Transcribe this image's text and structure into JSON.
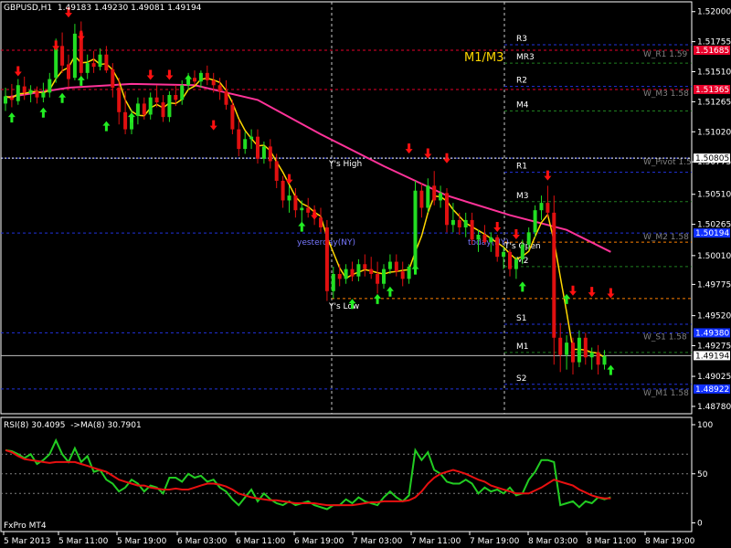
{
  "chart_data": {
    "type": "candlestick",
    "header": {
      "symbol": "GBPUSD,H1",
      "open": "1.49183",
      "high": "1.49230",
      "low": "1.49081",
      "close": "1.49194"
    },
    "price_axis_ticks": [
      {
        "value": 1.52,
        "label": "1.52000"
      },
      {
        "value": 1.51755,
        "label": "1.51755"
      },
      {
        "value": 1.5151,
        "label": "1.51510"
      },
      {
        "value": 1.51265,
        "label": "1.51265"
      },
      {
        "value": 1.5102,
        "label": "1.51020"
      },
      {
        "value": 1.50775,
        "label": "1.50775"
      },
      {
        "value": 1.5051,
        "label": "1.50510"
      },
      {
        "value": 1.50265,
        "label": "1.50265"
      },
      {
        "value": 1.5001,
        "label": "1.50010"
      },
      {
        "value": 1.49775,
        "label": "1.49775"
      },
      {
        "value": 1.4952,
        "label": "1.49520"
      },
      {
        "value": 1.49275,
        "label": "1.49275"
      },
      {
        "value": 1.49025,
        "label": "1.49025"
      },
      {
        "value": 1.4878,
        "label": "1.48780"
      }
    ],
    "price_range": [
      1.4872,
      1.5208
    ],
    "price_labels": [
      {
        "value": 1.51685,
        "label": "1.51685",
        "color": "#e8002a"
      },
      {
        "value": 1.51365,
        "label": "1.51365",
        "color": "#e8002a"
      },
      {
        "value": 1.50805,
        "label": "1.50805",
        "color": "#ffffff"
      },
      {
        "value": 1.50194,
        "label": "1.50194",
        "color": "#1030ff"
      },
      {
        "value": 1.4938,
        "label": "1.49380",
        "color": "#1030ff"
      },
      {
        "value": 1.49194,
        "label": "1.49194",
        "color": "#ffffff"
      },
      {
        "value": 1.48922,
        "label": "1.48922",
        "color": "#1030ff"
      }
    ],
    "time_axis": [
      "5 Mar 2013",
      "5 Mar 11:00",
      "5 Mar 19:00",
      "6 Mar 03:00",
      "6 Mar 11:00",
      "6 Mar 19:00",
      "7 Mar 03:00",
      "7 Mar 11:00",
      "7 Mar 19:00",
      "8 Mar 03:00",
      "8 Mar 11:00",
      "8 Mar 19:00"
    ],
    "levels": [
      {
        "label": "R3",
        "value": 1.5173,
        "color": "#2233dd",
        "style": "dash"
      },
      {
        "label": "MR3",
        "value": 1.5158,
        "color": "#208020",
        "style": "dash"
      },
      {
        "label": "R2",
        "value": 1.5139,
        "color": "#2233dd",
        "style": "dash"
      },
      {
        "label": "M4",
        "value": 1.5119,
        "color": "#208020",
        "style": "dash"
      },
      {
        "label": "R1",
        "value": 1.5069,
        "color": "#2233dd",
        "style": "dash"
      },
      {
        "label": "M3",
        "value": 1.5045,
        "color": "#208020",
        "style": "dash"
      },
      {
        "label": "M2",
        "value": 1.4992,
        "color": "#208020",
        "style": "dash"
      },
      {
        "label": "S1",
        "value": 1.4945,
        "color": "#2233dd",
        "style": "dash"
      },
      {
        "label": "M1",
        "value": 1.4922,
        "color": "#208020",
        "style": "dash"
      },
      {
        "label": "S2",
        "value": 1.4896,
        "color": "#2233dd",
        "style": "dash"
      }
    ],
    "weekly_levels": [
      {
        "label": "W_R1 1.59",
        "value": 1.51685,
        "color": "#e8002a"
      },
      {
        "label": "W_M3 1.58",
        "value": 1.51365,
        "color": "#e8002a"
      },
      {
        "label": "W_Pivot 1.5",
        "value": 1.50805,
        "color": "#2233dd"
      },
      {
        "label": "W_M2 1.58",
        "value": 1.50194,
        "color": "#2233dd"
      },
      {
        "label": "W_S1 1.58",
        "value": 1.4938,
        "color": "#2233dd"
      },
      {
        "label": "W_M1 1.58",
        "value": 1.48922,
        "color": "#2233dd"
      }
    ],
    "other_lines": [
      {
        "name": "yesterday-high",
        "value": 1.50805,
        "color": "#ffffff"
      },
      {
        "name": "yesterday-low",
        "value": 1.4966,
        "color": "#ff8000"
      },
      {
        "name": "today-open",
        "value": 1.5012,
        "color": "#ff8000"
      },
      {
        "name": "current-price",
        "value": 1.49194,
        "color": "#c0c0c0"
      }
    ],
    "annotations": [
      {
        "text": "Y's High",
        "color": "#ffffff"
      },
      {
        "text": "Y's Low",
        "color": "#ffffff"
      },
      {
        "text": "yesterday(NY)",
        "color": "#7777ff"
      },
      {
        "text": "today(NY)",
        "color": "#7777ff"
      },
      {
        "text": "M1/M3",
        "color": "#ffd700"
      },
      {
        "text": "T's Open",
        "color": "#ffffff"
      }
    ],
    "candles": [
      [
        1.5125,
        1.5138,
        1.5119,
        1.5131
      ],
      [
        1.513,
        1.5141,
        1.5122,
        1.5128
      ],
      [
        1.5127,
        1.5145,
        1.5124,
        1.514
      ],
      [
        1.5139,
        1.5147,
        1.5128,
        1.5134
      ],
      [
        1.5133,
        1.514,
        1.5126,
        1.5136
      ],
      [
        1.5135,
        1.5139,
        1.5125,
        1.513
      ],
      [
        1.513,
        1.5142,
        1.5126,
        1.5134
      ],
      [
        1.5134,
        1.515,
        1.513,
        1.5145
      ],
      [
        1.5146,
        1.5178,
        1.5142,
        1.5172
      ],
      [
        1.5172,
        1.5183,
        1.515,
        1.5156
      ],
      [
        1.5157,
        1.5165,
        1.5138,
        1.5145
      ],
      [
        1.5146,
        1.519,
        1.5144,
        1.5182
      ],
      [
        1.5183,
        1.5192,
        1.514,
        1.515
      ],
      [
        1.515,
        1.5165,
        1.5145,
        1.5158
      ],
      [
        1.5158,
        1.5168,
        1.515,
        1.5155
      ],
      [
        1.5155,
        1.517,
        1.5152,
        1.5165
      ],
      [
        1.5165,
        1.5172,
        1.515,
        1.5152
      ],
      [
        1.5153,
        1.5158,
        1.513,
        1.5138
      ],
      [
        1.5138,
        1.5146,
        1.5108,
        1.5118
      ],
      [
        1.5118,
        1.5135,
        1.51,
        1.5104
      ],
      [
        1.5104,
        1.512,
        1.51,
        1.5115
      ],
      [
        1.5115,
        1.513,
        1.5108,
        1.5125
      ],
      [
        1.5125,
        1.513,
        1.5112,
        1.5116
      ],
      [
        1.5116,
        1.5134,
        1.5112,
        1.513
      ],
      [
        1.513,
        1.514,
        1.5122,
        1.5126
      ],
      [
        1.5126,
        1.5132,
        1.511,
        1.5114
      ],
      [
        1.5114,
        1.5135,
        1.511,
        1.5132
      ],
      [
        1.5132,
        1.514,
        1.5123,
        1.5128
      ],
      [
        1.5128,
        1.5144,
        1.5124,
        1.514
      ],
      [
        1.514,
        1.515,
        1.5136,
        1.5146
      ],
      [
        1.5146,
        1.5152,
        1.514,
        1.5143
      ],
      [
        1.5143,
        1.5152,
        1.5138,
        1.515
      ],
      [
        1.515,
        1.5156,
        1.514,
        1.5144
      ],
      [
        1.5144,
        1.515,
        1.5134,
        1.514
      ],
      [
        1.514,
        1.5146,
        1.5128,
        1.5135
      ],
      [
        1.5135,
        1.5144,
        1.512,
        1.5124
      ],
      [
        1.5124,
        1.5128,
        1.51,
        1.5104
      ],
      [
        1.5104,
        1.5112,
        1.5082,
        1.5088
      ],
      [
        1.5088,
        1.5102,
        1.5084,
        1.5096
      ],
      [
        1.5096,
        1.5104,
        1.5088,
        1.5098
      ],
      [
        1.5098,
        1.5104,
        1.5076,
        1.508
      ],
      [
        1.508,
        1.5094,
        1.5076,
        1.509
      ],
      [
        1.509,
        1.5096,
        1.5072,
        1.5078
      ],
      [
        1.5078,
        1.5084,
        1.5056,
        1.5062
      ],
      [
        1.5062,
        1.5066,
        1.504,
        1.5046
      ],
      [
        1.5046,
        1.5058,
        1.5036,
        1.505
      ],
      [
        1.505,
        1.5056,
        1.5032,
        1.5038
      ],
      [
        1.5038,
        1.5046,
        1.5028,
        1.504
      ],
      [
        1.504,
        1.5048,
        1.5032,
        1.5036
      ],
      [
        1.5036,
        1.5042,
        1.5026,
        1.5032
      ],
      [
        1.5032,
        1.504,
        1.502,
        1.5024
      ],
      [
        1.5024,
        1.503,
        1.4964,
        1.4972
      ],
      [
        1.4972,
        1.4992,
        1.4966,
        1.4986
      ],
      [
        1.4986,
        1.4994,
        1.4976,
        1.4982
      ],
      [
        1.4982,
        1.4994,
        1.4978,
        1.499
      ],
      [
        1.499,
        1.4996,
        1.498,
        1.4984
      ],
      [
        1.4984,
        1.4998,
        1.498,
        1.4994
      ],
      [
        1.4994,
        1.5002,
        1.4984,
        1.499
      ],
      [
        1.499,
        1.5,
        1.4982,
        1.4986
      ],
      [
        1.4986,
        1.4996,
        1.497,
        1.4978
      ],
      [
        1.4978,
        1.4994,
        1.4974,
        1.499
      ],
      [
        1.499,
        1.5002,
        1.4986,
        1.4996
      ],
      [
        1.4996,
        1.5002,
        1.4984,
        1.4988
      ],
      [
        1.4988,
        1.4996,
        1.4976,
        1.4982
      ],
      [
        1.4982,
        1.4994,
        1.4978,
        1.4992
      ],
      [
        1.4992,
        1.5062,
        1.499,
        1.5054
      ],
      [
        1.5054,
        1.506,
        1.5032,
        1.504
      ],
      [
        1.504,
        1.5064,
        1.5036,
        1.5058
      ],
      [
        1.5058,
        1.507,
        1.5042,
        1.5046
      ],
      [
        1.5046,
        1.5058,
        1.504,
        1.5052
      ],
      [
        1.5052,
        1.5056,
        1.502,
        1.5026
      ],
      [
        1.5026,
        1.5044,
        1.502,
        1.503
      ],
      [
        1.503,
        1.5036,
        1.5018,
        1.5024
      ],
      [
        1.5024,
        1.5036,
        1.5016,
        1.503
      ],
      [
        1.503,
        1.5036,
        1.501,
        1.5014
      ],
      [
        1.5014,
        1.5022,
        1.5004,
        1.5018
      ],
      [
        1.5018,
        1.5026,
        1.501,
        1.5012
      ],
      [
        1.5012,
        1.502,
        1.5004,
        1.5016
      ],
      [
        1.5016,
        1.5018,
        1.4996,
        1.5
      ],
      [
        1.5,
        1.5008,
        1.499,
        1.5004
      ],
      [
        1.5004,
        1.5006,
        1.4984,
        1.499
      ],
      [
        1.499,
        1.5,
        1.4982,
        1.4998
      ],
      [
        1.4998,
        1.5014,
        1.4994,
        1.501
      ],
      [
        1.501,
        1.5024,
        1.5006,
        1.502
      ],
      [
        1.502,
        1.5042,
        1.5016,
        1.5038
      ],
      [
        1.5038,
        1.505,
        1.503,
        1.5044
      ],
      [
        1.5044,
        1.5058,
        1.5032,
        1.5036
      ],
      [
        1.5036,
        1.505,
        1.4912,
        1.4934
      ],
      [
        1.4934,
        1.4946,
        1.4906,
        1.492
      ],
      [
        1.492,
        1.4936,
        1.4908,
        1.493
      ],
      [
        1.493,
        1.4934,
        1.4904,
        1.4914
      ],
      [
        1.4914,
        1.494,
        1.491,
        1.4934
      ],
      [
        1.4934,
        1.4938,
        1.4912,
        1.4918
      ],
      [
        1.4918,
        1.4926,
        1.4908,
        1.4922
      ],
      [
        1.4922,
        1.4928,
        1.4904,
        1.4912
      ],
      [
        1.4912,
        1.4924,
        1.4908,
        1.4919
      ]
    ],
    "ma_fast_color": "#ffd700",
    "ma_slow_color": "#ff3399",
    "ma_slow": [
      [
        0,
        1.513
      ],
      [
        10,
        1.5138
      ],
      [
        20,
        1.5141
      ],
      [
        30,
        1.514
      ],
      [
        40,
        1.5128
      ],
      [
        50,
        1.51
      ],
      [
        60,
        1.5074
      ],
      [
        70,
        1.505
      ],
      [
        80,
        1.5034
      ],
      [
        89,
        1.5022
      ],
      [
        96,
        1.5004
      ]
    ],
    "arrows_down": [
      [
        2,
        1.5151
      ],
      [
        8,
        1.5172
      ],
      [
        10,
        1.5199
      ],
      [
        12,
        1.518
      ],
      [
        23,
        1.5148
      ],
      [
        26,
        1.5148
      ],
      [
        33,
        1.5107
      ],
      [
        45,
        1.5063
      ],
      [
        49,
        1.5034
      ],
      [
        64,
        1.5088
      ],
      [
        67,
        1.5084
      ],
      [
        70,
        1.508
      ],
      [
        78,
        1.5024
      ],
      [
        81,
        1.5018
      ],
      [
        86,
        1.5066
      ],
      [
        90,
        1.4972
      ],
      [
        93,
        1.4971
      ],
      [
        96,
        1.497
      ]
    ],
    "arrows_up": [
      [
        1,
        1.5114
      ],
      [
        6,
        1.5118
      ],
      [
        9,
        1.513
      ],
      [
        12,
        1.5144
      ],
      [
        16,
        1.5107
      ],
      [
        20,
        1.5114
      ],
      [
        29,
        1.5145
      ],
      [
        47,
        1.5025
      ],
      [
        55,
        1.4962
      ],
      [
        59,
        1.4966
      ],
      [
        61,
        1.4972
      ],
      [
        65,
        1.499
      ],
      [
        82,
        1.4976
      ],
      [
        89,
        1.4966
      ],
      [
        96,
        1.4908
      ]
    ],
    "rsi": {
      "label": "RSI(8) 30.4095",
      "ma_label": "->MA(8) 30.7901",
      "levels": [
        70,
        50,
        30
      ],
      "axis_labels": [
        "100",
        "50",
        "0"
      ],
      "range": [
        0,
        100
      ],
      "color": "#22cc22",
      "ma_color": "#e81010",
      "values": [
        74,
        73,
        70,
        66,
        70,
        60,
        64,
        70,
        84,
        70,
        62,
        76,
        62,
        68,
        52,
        54,
        44,
        40,
        32,
        36,
        44,
        40,
        32,
        38,
        36,
        30,
        46,
        46,
        42,
        50,
        46,
        48,
        42,
        44,
        36,
        32,
        24,
        18,
        26,
        34,
        22,
        30,
        24,
        20,
        18,
        22,
        18,
        20,
        22,
        18,
        16,
        14,
        18,
        18,
        24,
        20,
        26,
        22,
        20,
        18,
        26,
        32,
        26,
        22,
        28,
        74,
        64,
        72,
        54,
        50,
        42,
        40,
        40,
        44,
        40,
        30,
        36,
        32,
        34,
        30,
        36,
        28,
        30,
        44,
        52,
        64,
        64,
        62,
        18,
        20,
        22,
        16,
        22,
        20,
        26,
        24,
        26
      ],
      "ma_values": [
        74,
        72,
        68,
        65,
        64,
        63,
        62,
        61,
        62,
        62,
        62,
        62,
        60,
        58,
        56,
        54,
        52,
        48,
        44,
        42,
        40,
        38,
        38,
        36,
        35,
        34,
        34,
        35,
        34,
        34,
        36,
        38,
        40,
        40,
        39,
        37,
        34,
        30,
        28,
        26,
        25,
        24,
        23,
        23,
        22,
        21,
        20,
        20,
        20,
        20,
        19,
        18,
        18,
        18,
        18,
        18,
        19,
        20,
        21,
        21,
        22,
        22,
        22,
        22,
        23,
        26,
        32,
        40,
        46,
        50,
        52,
        54,
        52,
        50,
        47,
        44,
        42,
        38,
        36,
        34,
        32,
        30,
        30,
        30,
        33,
        36,
        40,
        44,
        42,
        40,
        38,
        34,
        31,
        28,
        26,
        25,
        25
      ]
    },
    "footer_label": "FxPro MT4",
    "grid": false
  }
}
